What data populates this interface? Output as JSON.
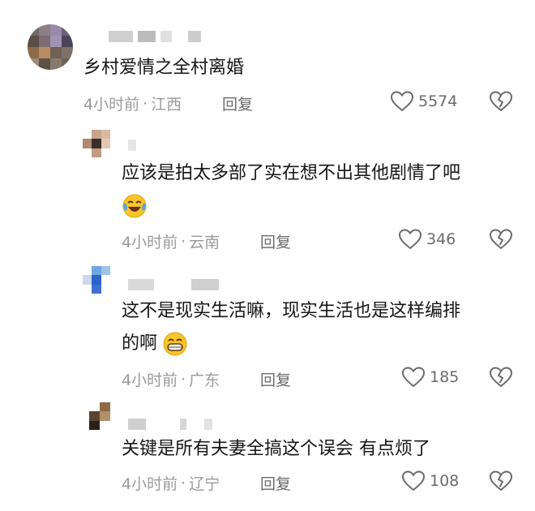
{
  "comments": [
    {
      "text": "乡村爱情之全村离婚",
      "time": "4小时前",
      "location": "江西",
      "reply_label": "回复",
      "likes": "5574"
    },
    {
      "text": "应该是拍太多部了实在想不出其他剧情了吧",
      "emoji": "laughing-tears-emoji",
      "time": "4小时前",
      "location": "云南",
      "reply_label": "回复",
      "likes": "346"
    },
    {
      "text_line1": "这不是现实生活嘛，现实生活也是这样编排",
      "text_line2": "的啊",
      "emoji": "grinning-emoji",
      "time": "4小时前",
      "location": "广东",
      "reply_label": "回复",
      "likes": "185"
    },
    {
      "text": "关键是所有夫妻全搞这个误会 有点烦了",
      "time": "4小时前",
      "location": "辽宁",
      "reply_label": "回复",
      "likes": "108"
    }
  ],
  "dot_separator": "·"
}
